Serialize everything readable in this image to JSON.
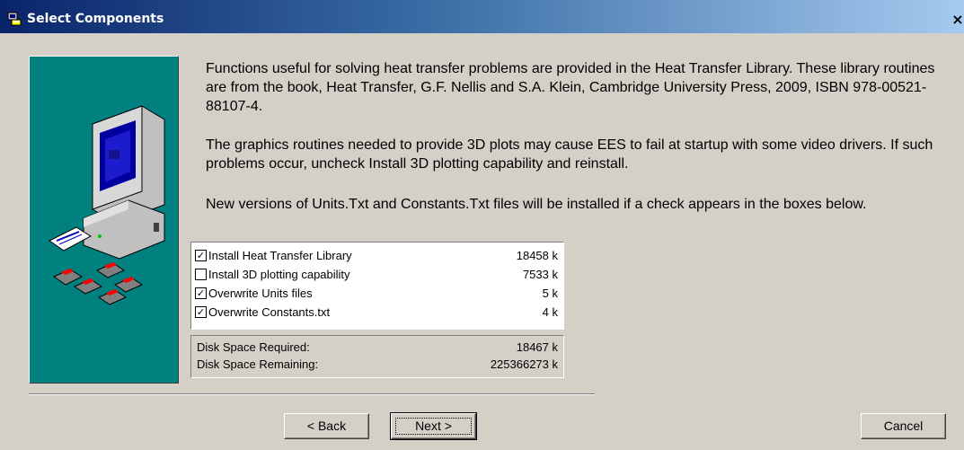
{
  "window": {
    "title": "Select Components",
    "close_label": "×"
  },
  "content": {
    "paragraphs": [
      "Functions useful for solving heat transfer problems are provided in the Heat Transfer Library.  These library routines are from the book, Heat Transfer, G.F. Nellis and S.A. Klein, Cambridge University Press, 2009, ISBN 978-00521-88107-4.",
      "The graphics routines needed to provide 3D plots may cause EES to fail at startup with some video drivers.  If such problems occur, uncheck Install 3D plotting capability and reinstall.",
      "New versions of Units.Txt and Constants.Txt files will be installed if a check appears in the boxes below."
    ]
  },
  "components": [
    {
      "label": "Install Heat Transfer Library",
      "size": "18458 k",
      "checked": true
    },
    {
      "label": "Install 3D plotting capability",
      "size": "7533 k",
      "checked": false
    },
    {
      "label": "Overwrite Units files",
      "size": "5 k",
      "checked": true
    },
    {
      "label": "Overwrite Constants.txt",
      "size": "4 k",
      "checked": true
    }
  ],
  "disk": {
    "required_label": "Disk Space Required:",
    "required_value": "18467 k",
    "remaining_label": "Disk Space Remaining:",
    "remaining_value": "225366273 k"
  },
  "buttons": {
    "back": "< Back",
    "next": "Next >",
    "cancel": "Cancel"
  },
  "icons": {
    "title": "installer-icon",
    "panel": "computer-with-disks-icon"
  }
}
